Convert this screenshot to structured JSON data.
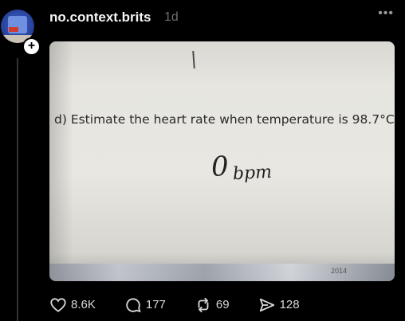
{
  "post": {
    "username": "no.context.brits",
    "time": "1d",
    "more_icon": "more-icon"
  },
  "photo": {
    "question": "d)  Estimate the heart rate when temperature is 98.7°C.",
    "answer_value": "0",
    "answer_unit": "bpm",
    "corner_text": "2014"
  },
  "actions": {
    "likes": "8.6K",
    "comments": "177",
    "reposts": "69",
    "shares": "128"
  },
  "colors": {
    "background": "#000000",
    "username": "#f5f5f5",
    "muted": "#6e6e6e"
  }
}
